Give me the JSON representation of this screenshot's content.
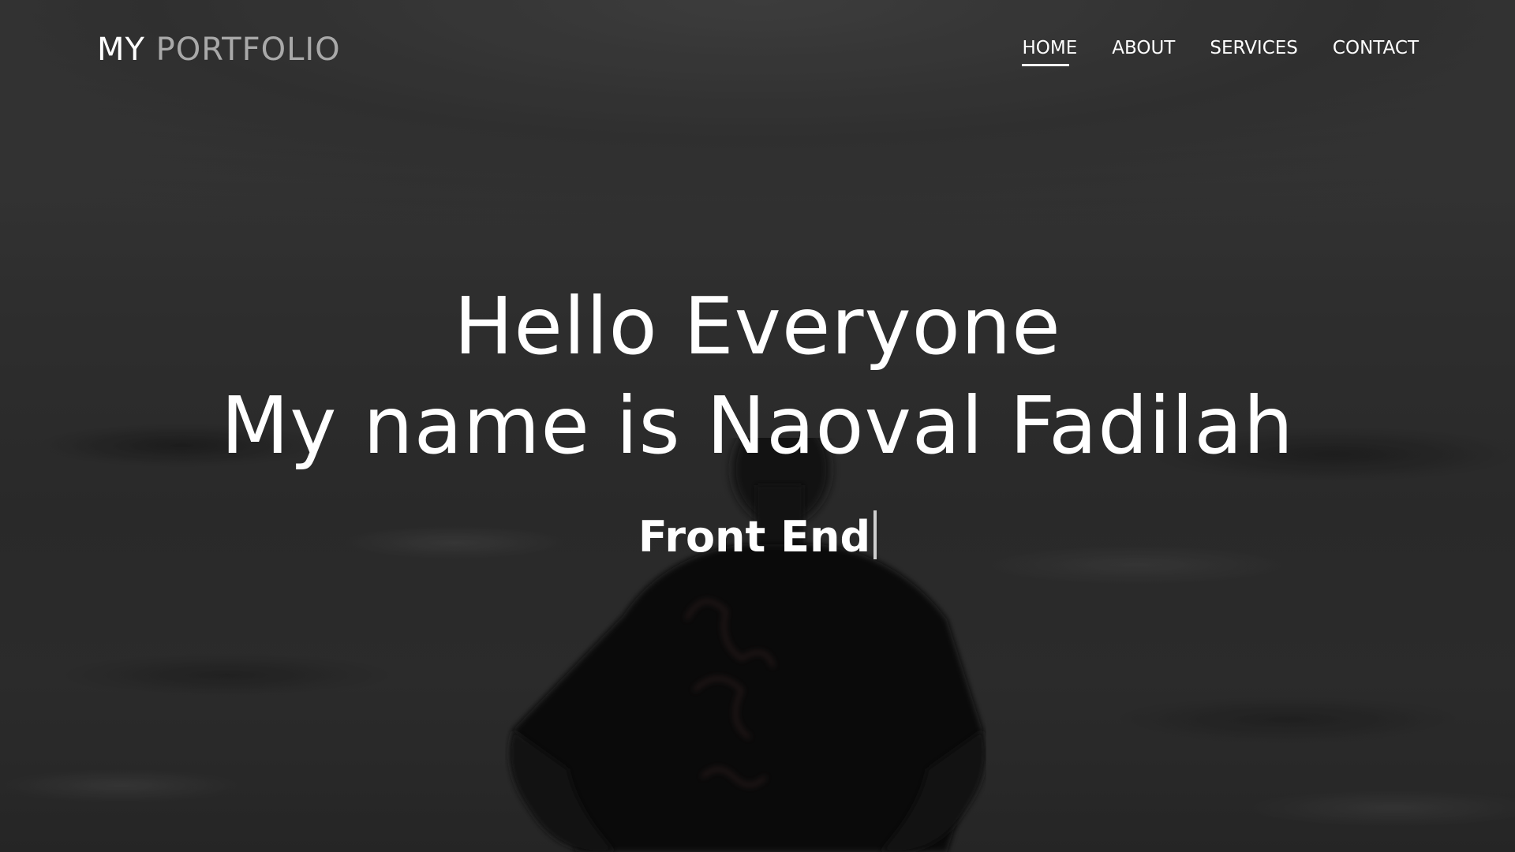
{
  "nav": {
    "brand_my": "MY",
    "brand_portfolio": "PORTFOLIO",
    "items": [
      {
        "label": "HOME",
        "active": true
      },
      {
        "label": "ABOUT",
        "active": false
      },
      {
        "label": "SERVICES",
        "active": false
      },
      {
        "label": "CONTACT",
        "active": false
      }
    ]
  },
  "hero": {
    "greeting": "Hello Everyone",
    "intro": "My name is Naoval Fadilah",
    "role": "Front End"
  },
  "colors": {
    "text": "#ffffff",
    "brand_muted": "#a9a9a9",
    "background": "#3a3a3a"
  }
}
